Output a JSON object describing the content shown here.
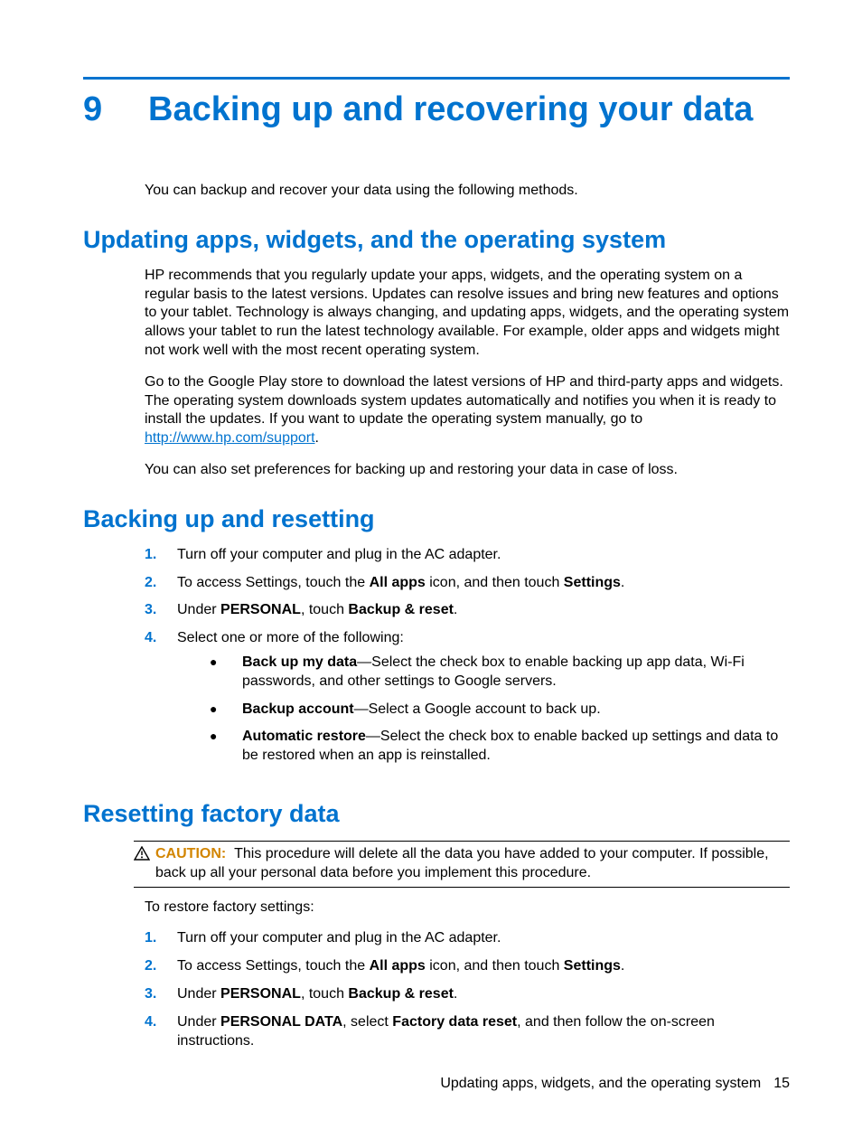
{
  "chapter": {
    "number": "9",
    "title": "Backing up and recovering your data"
  },
  "intro": "You can backup and recover your data using the following methods.",
  "sectionA": {
    "heading": "Updating apps, widgets, and the operating system",
    "p1": "HP recommends that you regularly update your apps, widgets, and the operating system on a regular basis to the latest versions. Updates can resolve issues and bring new features and options to your tablet. Technology is always changing, and updating apps, widgets, and the operating system allows your tablet to run the latest technology available. For example, older apps and widgets might not work well with the most recent operating system.",
    "p2a": "Go to the Google Play store to download the latest versions of HP and third-party apps and widgets. The operating system downloads system updates automatically and notifies you when it is ready to install the updates. If you want to update the operating system manually, go to ",
    "p2link": "http://www.hp.com/support",
    "p2b": ".",
    "p3": "You can also set preferences for backing up and restoring your data in case of loss."
  },
  "sectionB": {
    "heading": "Backing up and resetting",
    "steps": {
      "s1": "Turn off your computer and plug in the AC adapter.",
      "s2a": "To access Settings, touch the ",
      "s2b": "All apps",
      "s2c": " icon, and then touch ",
      "s2d": "Settings",
      "s2e": ".",
      "s3a": "Under ",
      "s3b": "PERSONAL",
      "s3c": ", touch ",
      "s3d": "Backup & reset",
      "s3e": ".",
      "s4": "Select one or more of the following:",
      "b1a": "Back up my data",
      "b1b": "—Select the check box to enable backing up app data, Wi-Fi passwords, and other settings to Google servers.",
      "b2a": "Backup account",
      "b2b": "—Select a Google account to back up.",
      "b3a": "Automatic restore",
      "b3b": "—Select the check box to enable backed up settings and data to be restored when an app is reinstalled."
    }
  },
  "sectionC": {
    "heading": "Resetting factory data",
    "cautionLabel": "CAUTION:",
    "cautionText": "This procedure will delete all the data you have added to your computer. If possible, back up all your personal data before you implement this procedure.",
    "intro": "To restore factory settings:",
    "steps": {
      "s1": "Turn off your computer and plug in the AC adapter.",
      "s2a": "To access Settings, touch the ",
      "s2b": "All apps",
      "s2c": " icon, and then touch ",
      "s2d": "Settings",
      "s2e": ".",
      "s3a": "Under ",
      "s3b": "PERSONAL",
      "s3c": ", touch ",
      "s3d": "Backup & reset",
      "s3e": ".",
      "s4a": "Under ",
      "s4b": "PERSONAL DATA",
      "s4c": ", select ",
      "s4d": "Factory data reset",
      "s4e": ", and then follow the on-screen instructions."
    }
  },
  "footer": {
    "text": "Updating apps, widgets, and the operating system",
    "page": "15"
  }
}
